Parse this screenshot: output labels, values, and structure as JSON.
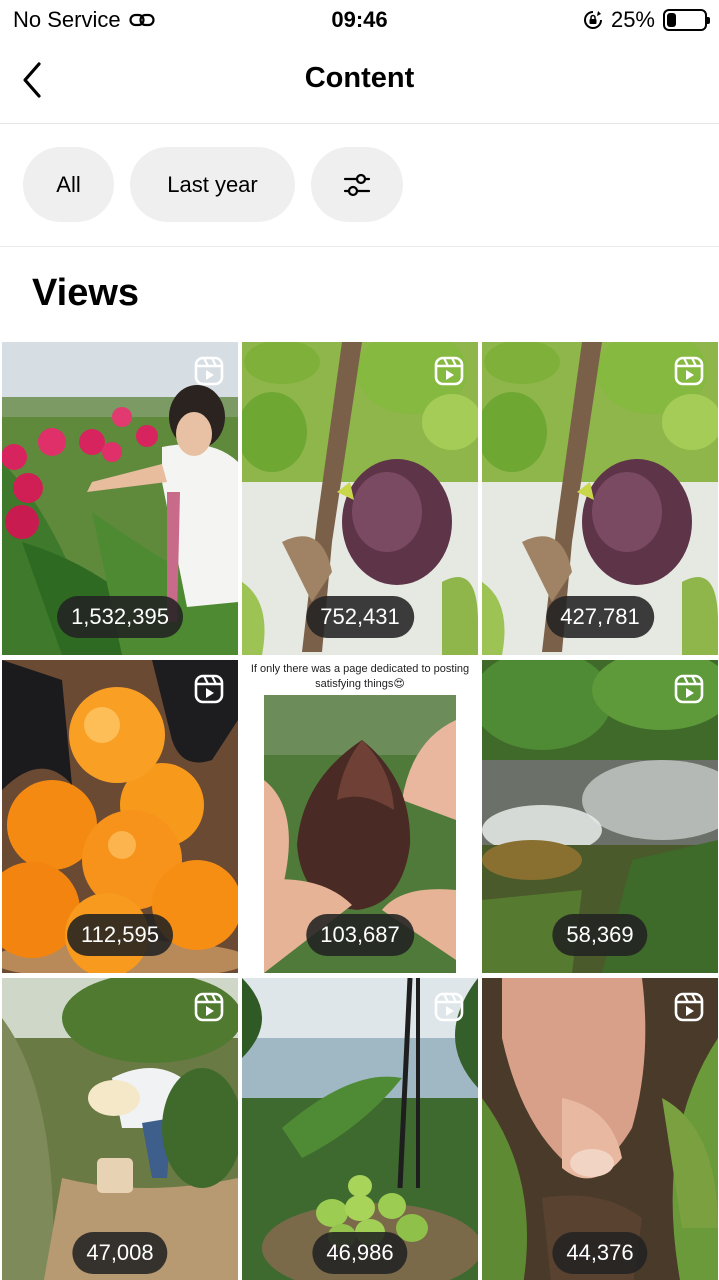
{
  "status_bar": {
    "carrier": "No Service",
    "time": "09:46",
    "battery_percent": "25%",
    "battery_level": 0.25,
    "link_icon": "link-icon",
    "rotation_lock_icon": "rotation-lock-icon"
  },
  "nav": {
    "title": "Content",
    "back_icon": "chevron-left-icon"
  },
  "filters": {
    "content_type": "All",
    "date_range": "Last year",
    "settings_icon": "sliders-icon"
  },
  "section": {
    "title": "Views"
  },
  "posts": [
    {
      "views": "1,532,395",
      "type_icon": "reels-icon",
      "subject": "dragon-fruit"
    },
    {
      "views": "752,431",
      "type_icon": "reels-icon",
      "subject": "fig"
    },
    {
      "views": "427,781",
      "type_icon": "reels-icon",
      "subject": "fig"
    },
    {
      "views": "112,595",
      "type_icon": "reels-icon",
      "subject": "candied-oranges"
    },
    {
      "views": "103,687",
      "type_icon": "reels-icon",
      "subject": "snake-fruit",
      "caption": "If only there was a page dedicated to posting satisfying things😍"
    },
    {
      "views": "58,369",
      "type_icon": "reels-icon",
      "subject": "hot-spring"
    },
    {
      "views": "47,008",
      "type_icon": "reels-icon",
      "subject": "farmer"
    },
    {
      "views": "46,986",
      "type_icon": "reels-icon",
      "subject": "green-fruit"
    },
    {
      "views": "44,376",
      "type_icon": "reels-icon",
      "subject": "digging"
    }
  ],
  "colors": {
    "chip_background": "#efefef",
    "badge_background": "#222222",
    "text": "#000000"
  }
}
